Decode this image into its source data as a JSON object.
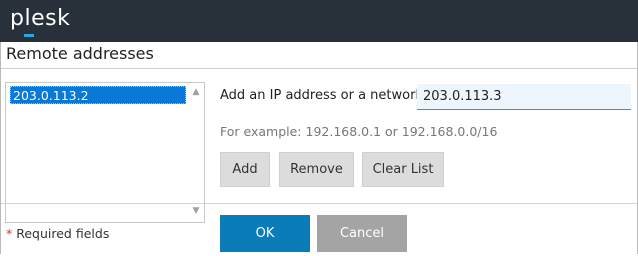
{
  "app": {
    "logo_text": "plesk"
  },
  "dialog": {
    "title": "Remote addresses",
    "list": {
      "items": [
        "203.0.113.2"
      ]
    },
    "ip_field": {
      "label": "Add an IP address or a network:",
      "value": "203.0.113.3"
    },
    "example_text": "For example: 192.168.0.1 or 192.168.0.0/16",
    "buttons": {
      "add": "Add",
      "remove": "Remove",
      "clear": "Clear List"
    },
    "footer": {
      "required_star": "*",
      "required_text": "Required fields",
      "ok": "OK",
      "cancel": "Cancel"
    }
  },
  "colors": {
    "titlebar": "#28313a",
    "accent": "#0a7cb8",
    "selection": "#0a78d7"
  }
}
